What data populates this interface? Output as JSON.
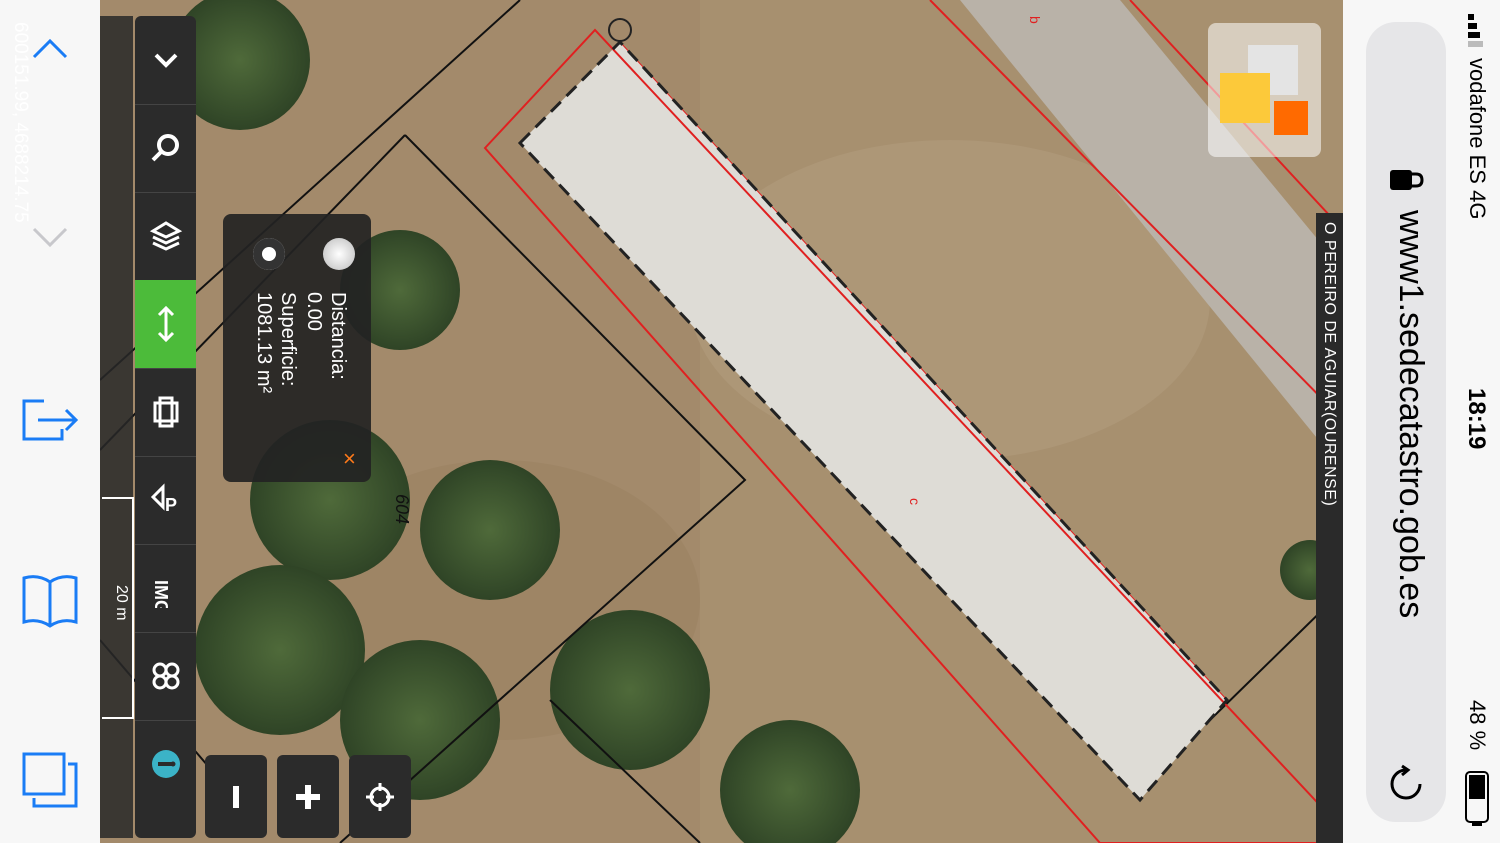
{
  "browser": {
    "url": "www1.sedecatastro.gob.es",
    "status": {
      "carrier": "vodafone ES 4G",
      "time": "18:19",
      "battery": "48 %"
    }
  },
  "map": {
    "coordinates": "600151.99, 4688214.75",
    "scale_label": "20 m",
    "parcel_label": "604",
    "municipality": "O PEREIRO DE AGUIAR(OURENSE)",
    "measurement": {
      "distance_label": "Distancia:",
      "distance_value": "0.00",
      "area_label": "Superficie:",
      "area_value": "1081.13 m²",
      "close_label": "×"
    }
  },
  "colors": {
    "active_tool": "#4cbb3a",
    "toolbar_bg": "#2b2b2b",
    "parcel_line": "#e02020",
    "accent": "#ff7a1a"
  },
  "tools": [
    {
      "name": "collapse-icon"
    },
    {
      "name": "search-icon"
    },
    {
      "name": "layers-icon"
    },
    {
      "name": "measure-icon",
      "active": true
    },
    {
      "name": "print-icon"
    },
    {
      "name": "identify-parcel-icon"
    },
    {
      "name": "image-icon"
    },
    {
      "name": "cadastre-icon"
    },
    {
      "name": "info-icon"
    }
  ],
  "controls": [
    {
      "name": "zoom-out-icon"
    },
    {
      "name": "zoom-in-icon"
    },
    {
      "name": "locate-icon"
    }
  ]
}
